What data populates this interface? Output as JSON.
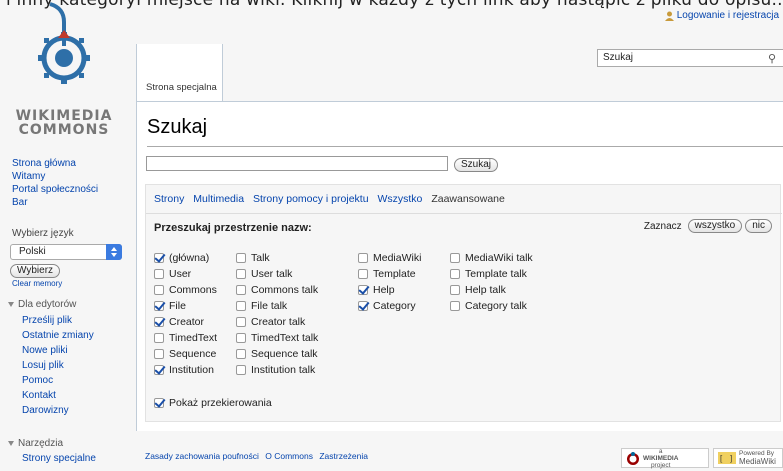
{
  "banner": {
    "cut_text": "i inny kategoryi miejsce na wiki. Kliknij w każdy z tych link aby nastąpić z pliku do opisu... Co ...",
    "login_link": "Logowanie i rejestracja"
  },
  "logo": {
    "line1": "WIKIMEDIA",
    "line2": "COMMONS",
    "icon": "commons-logo"
  },
  "sidebar": {
    "nav": [
      "Strona główna",
      "Witamy",
      "Portal społeczności",
      "Bar"
    ],
    "language": {
      "label": "Wybierz język",
      "selected": "Polski",
      "button": "Wybierz",
      "clear": "Clear memory"
    },
    "editors": {
      "heading": "Dla edytorów",
      "items": [
        "Prześlij plik",
        "Ostatnie zmiany",
        "Nowe pliki",
        "Losuj plik",
        "Pomoc",
        "Kontakt",
        "Darowizny"
      ]
    },
    "tools": {
      "heading": "Narzędzia",
      "items": [
        "Strony specjalne"
      ]
    }
  },
  "header": {
    "tab": "Strona specjalna",
    "search_value": "Szukaj",
    "search_icon": "magnifier-icon"
  },
  "page": {
    "title": "Szukaj",
    "query_value": "",
    "search_button": "Szukaj",
    "profiles": [
      "Strony",
      "Multimedia",
      "Strony pomocy i projektu",
      "Wszystko"
    ],
    "profile_current": "Zaawansowane",
    "ns_heading": "Przeszukaj przestrzenie nazw:",
    "toggle_label": "Zaznacz",
    "toggle_all": "wszystko",
    "toggle_none": "nic",
    "columns": [
      [
        {
          "label": "(główna)",
          "checked": true
        },
        {
          "label": "User",
          "checked": false
        },
        {
          "label": "Commons",
          "checked": false
        },
        {
          "label": "File",
          "checked": true
        },
        {
          "label": "Creator",
          "checked": true
        },
        {
          "label": "TimedText",
          "checked": false
        },
        {
          "label": "Sequence",
          "checked": false
        },
        {
          "label": "Institution",
          "checked": true
        }
      ],
      [
        {
          "label": "Talk",
          "checked": false
        },
        {
          "label": "User talk",
          "checked": false
        },
        {
          "label": "Commons talk",
          "checked": false
        },
        {
          "label": "File talk",
          "checked": false
        },
        {
          "label": "Creator talk",
          "checked": false
        },
        {
          "label": "TimedText talk",
          "checked": false
        },
        {
          "label": "Sequence talk",
          "checked": false
        },
        {
          "label": "Institution talk",
          "checked": false
        }
      ],
      [
        {
          "label": "MediaWiki",
          "checked": false
        },
        {
          "label": "Template",
          "checked": false
        },
        {
          "label": "Help",
          "checked": true
        },
        {
          "label": "Category",
          "checked": true
        }
      ],
      [
        {
          "label": "MediaWiki talk",
          "checked": false
        },
        {
          "label": "Template talk",
          "checked": false
        },
        {
          "label": "Help talk",
          "checked": false
        },
        {
          "label": "Category talk",
          "checked": false
        }
      ]
    ],
    "redirects": {
      "label": "Pokaż przekierowania",
      "checked": true
    }
  },
  "footer": {
    "links": [
      "Zasady zachowania poufności",
      "O Commons",
      "Zastrzeżenia"
    ],
    "badge1": {
      "line1": "a",
      "line2": "WIKIMEDIA",
      "line3": "project"
    },
    "badge2": {
      "line1": "Powered By",
      "line2": "MediaWiki"
    }
  },
  "colors": {
    "link": "#0645ad",
    "accent": "#3b7be0",
    "logo_blue": "#2e6fa8",
    "logo_red": "#c0392b"
  }
}
